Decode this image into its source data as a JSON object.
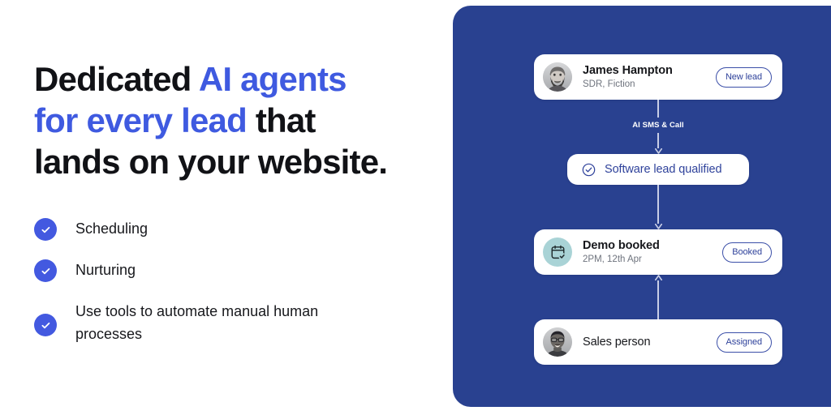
{
  "hero": {
    "headline_line1_plain": "Dedicated ",
    "headline_line1_accent": "AI agents",
    "headline_line2_accent": "for every lead",
    "headline_line2_plain": " that",
    "headline_line3_plain": "lands on your website.",
    "accent_color": "#3F5AE0",
    "text_color": "#111216"
  },
  "features": [
    {
      "label": "Scheduling",
      "icon": "check-circle-icon"
    },
    {
      "label": "Nurturing",
      "icon": "check-circle-icon"
    },
    {
      "label": "Use tools to automate manual human processes",
      "icon": "check-circle-icon"
    }
  ],
  "panel": {
    "background_color": "#294190",
    "connector_color": "#C8CEE6"
  },
  "flow": {
    "card_lead": {
      "name": "James Hampton",
      "subtitle": "SDR, Fiction",
      "badge": "New lead",
      "avatar": "bearded-man-avatar"
    },
    "connector_1": {
      "label": "AI SMS & Call",
      "direction": "down"
    },
    "card_qualified": {
      "label": "Software lead qualified",
      "icon": "check-circle-outline-icon"
    },
    "connector_2": {
      "label": "",
      "direction": "down"
    },
    "card_demo": {
      "name": "Demo booked",
      "subtitle": "2PM, 12th Apr",
      "badge": "Booked",
      "icon": "calendar-check-icon",
      "icon_background": "#A9D3D6"
    },
    "connector_3": {
      "label": "",
      "direction": "up"
    },
    "card_sales": {
      "name": "Sales person",
      "badge": "Assigned",
      "avatar": "man-with-glasses-avatar"
    }
  }
}
